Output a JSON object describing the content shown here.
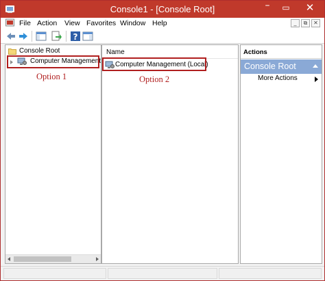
{
  "window": {
    "title": "Console1 - [Console Root]",
    "controls": {
      "minimize": "–",
      "maximize": "▭",
      "close": "✕"
    },
    "mdi_controls": {
      "minimize": "_",
      "restore": "⧉",
      "close": "✕"
    }
  },
  "menu": [
    "File",
    "Action",
    "View",
    "Favorites",
    "Window",
    "Help"
  ],
  "toolbar": {
    "buttons": [
      "back-icon",
      "forward-icon",
      "show-hide-tree-icon",
      "export-list-icon",
      "help-icon",
      "show-hide-action-pane-icon"
    ]
  },
  "tree": {
    "root": "Console Root",
    "child": "Computer Management"
  },
  "list": {
    "column_header": "Name",
    "item": "Computer Management (Local)"
  },
  "actions": {
    "header": "Actions",
    "group": "Console Root",
    "more": "More Actions"
  },
  "annotations": {
    "option1": "Option 1",
    "option2": "Option 2"
  },
  "colors": {
    "titlebar": "#c0392b",
    "actions_group": "#8aa9d6",
    "annotation": "#b01e1e"
  }
}
